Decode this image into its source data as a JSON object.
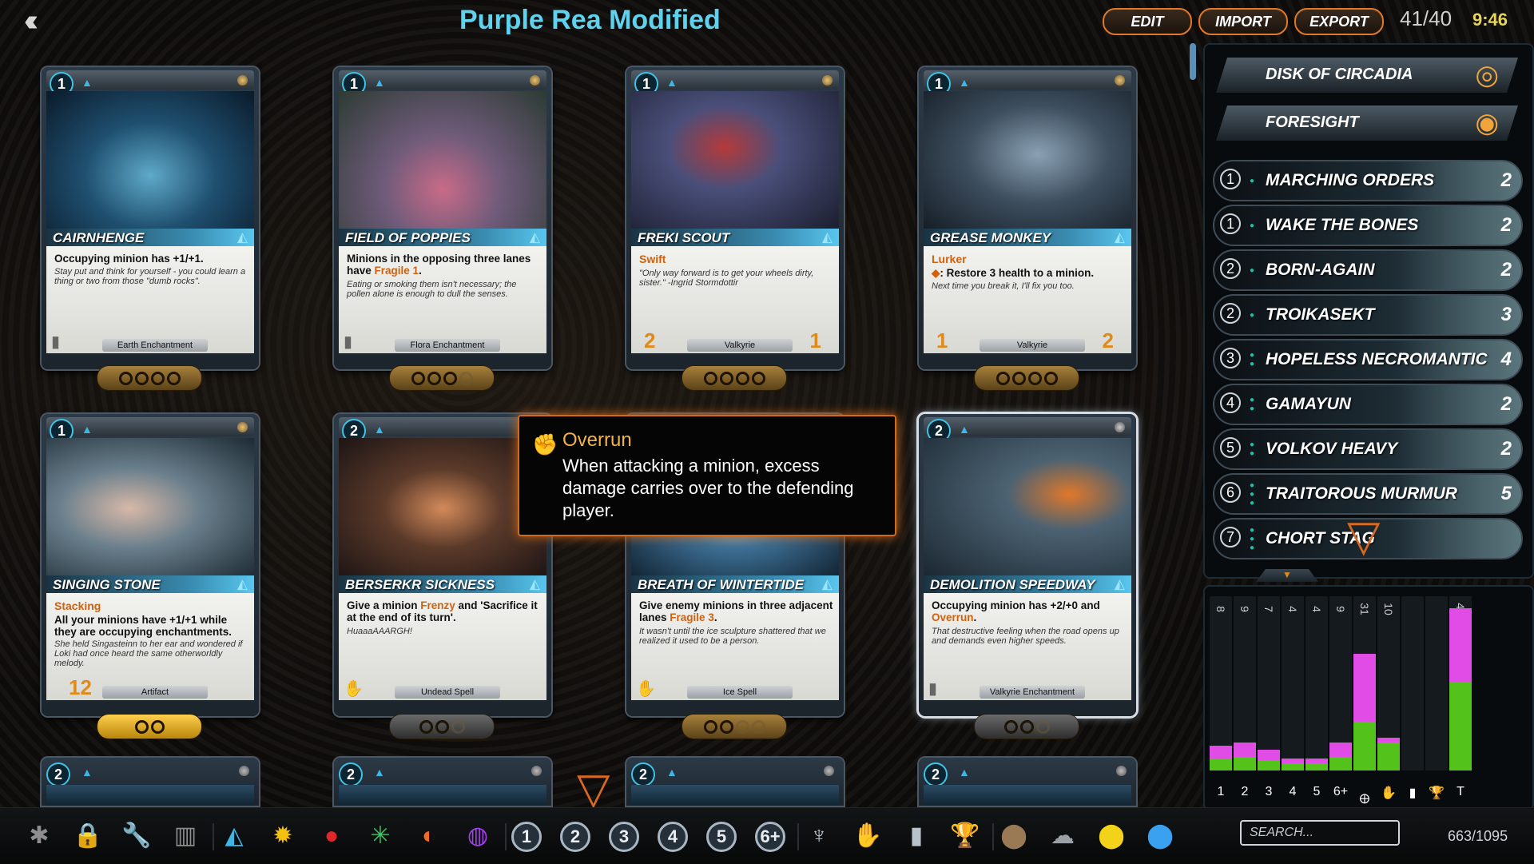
{
  "header": {
    "deck_title": "Purple Rea Modified",
    "buttons": [
      "EDIT",
      "IMPORT",
      "EXPORT"
    ],
    "card_count": "41/40",
    "clock": "9:46"
  },
  "cards": [
    {
      "cost": "1",
      "name": "CAIRNHENGE",
      "keyword": "",
      "rules": "Occupying minion has +1/+1.",
      "flavor": "Stay put and think for yourself - you could learn a thing or two from those \"dumb rocks\".",
      "type": "Earth Enchantment",
      "attack": "",
      "health": "",
      "copies": 4,
      "owned": 4
    },
    {
      "cost": "1",
      "name": "FIELD OF POPPIES",
      "keyword": "",
      "rules": "Minions in the opposing three lanes have Fragile 1.",
      "flavor": "Eating or smoking them isn't necessary; the pollen alone is enough to dull the senses.",
      "type": "Flora Enchantment",
      "attack": "",
      "health": "",
      "copies": 4,
      "owned": 3
    },
    {
      "cost": "1",
      "name": "FREKI SCOUT",
      "keyword": "Swift",
      "rules": "",
      "flavor": "\"Only way forward is to get your wheels dirty, sister.\" -Ingrid Stormdottir",
      "type": "Valkyrie",
      "attack": "2",
      "health": "1",
      "copies": 4,
      "owned": 4
    },
    {
      "cost": "1",
      "name": "GREASE MONKEY",
      "keyword": "Lurker",
      "rules": ": Restore 3 health to a minion.",
      "flavor": "Next time you break it, I'll fix you too.",
      "type": "Valkyrie",
      "attack": "1",
      "health": "2",
      "copies": 4,
      "owned": 4
    },
    {
      "cost": "1",
      "name": "SINGING STONE",
      "keyword": "Stacking",
      "rules": "All your minions have +1/+1 while they are occupying enchantments.",
      "flavor": "She held Singasteinn to her ear and wondered if Loki had once heard the same otherworldly melody.",
      "type": "Artifact",
      "attack": "12",
      "health": "",
      "copies": 2,
      "owned": 2
    },
    {
      "cost": "2",
      "name": "BERSERKR SICKNESS",
      "keyword": "",
      "rules": "Give a minion Frenzy and 'Sacrifice it at the end of its turn'.",
      "flavor": "HuaaaAAARGH!",
      "type": "Undead Spell",
      "attack": "",
      "health": "",
      "copies": 3,
      "owned": 2
    },
    {
      "cost": "",
      "name": "BREATH OF WINTERTIDE",
      "keyword": "",
      "rules": "Give enemy minions in three adjacent lanes Fragile 3.",
      "flavor": "It wasn't until the ice sculpture shattered that we realized it used to be a person.",
      "type": "Ice Spell",
      "attack": "",
      "health": "",
      "copies": 4,
      "owned": 2
    },
    {
      "cost": "2",
      "name": "DEMOLITION SPEEDWAY",
      "keyword": "",
      "rules": "Occupying minion has +2/+0 and Overrun.",
      "flavor": "That destructive feeling when the road opens up and demands even higher speeds.",
      "type": "Valkyrie Enchantment",
      "attack": "",
      "health": "",
      "copies": 3,
      "owned": 2
    }
  ],
  "peek_costs": [
    "2",
    "2",
    "2",
    "2"
  ],
  "tooltip": {
    "title": "Overrun",
    "body": "When attacking a minion, excess damage carries over to the defending player."
  },
  "relics": [
    {
      "name": "DISK OF CIRCADIA",
      "icon": "sun-disk-icon"
    },
    {
      "name": "FORESIGHT",
      "icon": "eye-of-horus-icon"
    }
  ],
  "decklist": [
    {
      "cost": "1",
      "name": "MARCHING ORDERS",
      "qty": "2"
    },
    {
      "cost": "1",
      "name": "WAKE THE BONES",
      "qty": "2"
    },
    {
      "cost": "2",
      "name": "BORN-AGAIN",
      "qty": "2"
    },
    {
      "cost": "2",
      "name": "TROIKASEKT",
      "qty": "3"
    },
    {
      "cost": "3",
      "name": "HOPELESS NECROMANTIC",
      "qty": "4"
    },
    {
      "cost": "4",
      "name": "GAMAYUN",
      "qty": "2"
    },
    {
      "cost": "5",
      "name": "VOLKOV HEAVY",
      "qty": "2"
    },
    {
      "cost": "6",
      "name": "TRAITOROUS MURMUR",
      "qty": "5"
    },
    {
      "cost": "7",
      "name": "CHORT STAG",
      "qty": ""
    }
  ],
  "mana_curve": {
    "columns": [
      {
        "label": "1",
        "count": "8",
        "pink": 0.07,
        "green": 0.07
      },
      {
        "label": "2",
        "count": "9",
        "pink": 0.08,
        "green": 0.08
      },
      {
        "label": "3",
        "count": "7",
        "pink": 0.06,
        "green": 0.06
      },
      {
        "label": "4",
        "count": "4",
        "pink": 0.03,
        "green": 0.04
      },
      {
        "label": "5",
        "count": "4",
        "pink": 0.03,
        "green": 0.04
      },
      {
        "label": "6+",
        "count": "9",
        "pink": 0.08,
        "green": 0.08
      },
      {
        "label": "minion",
        "count": "31",
        "pink": 0.39,
        "green": 0.28
      },
      {
        "label": "spell",
        "count": "10",
        "pink": 0.03,
        "green": 0.16
      },
      {
        "label": "enchantment",
        "count": "",
        "pink": 0,
        "green": 0
      },
      {
        "label": "artifact",
        "count": "",
        "pink": 0,
        "green": 0
      },
      {
        "label": "T",
        "count": "41",
        "pink": 0.42,
        "green": 0.51
      }
    ],
    "colors": {
      "pink": "#e24ce6",
      "green": "#53c21a"
    }
  },
  "filters": {
    "misc": [
      "gear-icon",
      "lock-icon",
      "wrench-icon",
      "library-icon"
    ],
    "factions": [
      {
        "icon": "triangle-faction-icon",
        "color": "#3fb7e4"
      },
      {
        "icon": "gear-faction-icon",
        "color": "#f2c20e"
      },
      {
        "icon": "crimson-faction-icon",
        "color": "#e1262a"
      },
      {
        "icon": "leaf-faction-icon",
        "color": "#3cc763"
      },
      {
        "icon": "flame-faction-icon",
        "color": "#f26a21"
      },
      {
        "icon": "void-faction-icon",
        "color": "#a040e8"
      }
    ],
    "costs": [
      "1",
      "2",
      "3",
      "4",
      "5",
      "6+"
    ],
    "types": [
      "minion-icon",
      "spell-icon",
      "enchantment-icon",
      "artifact-icon"
    ],
    "rarities": [
      {
        "icon": "common-icon",
        "color": "#9a7a55"
      },
      {
        "icon": "uncommon-icon",
        "color": "#9aa0a6"
      },
      {
        "icon": "rare-icon",
        "color": "#f3d21a"
      },
      {
        "icon": "legendary-icon",
        "color": "#3aa0f0"
      }
    ]
  },
  "search": {
    "placeholder": "SEARCH..."
  },
  "pagination": "663/1095"
}
